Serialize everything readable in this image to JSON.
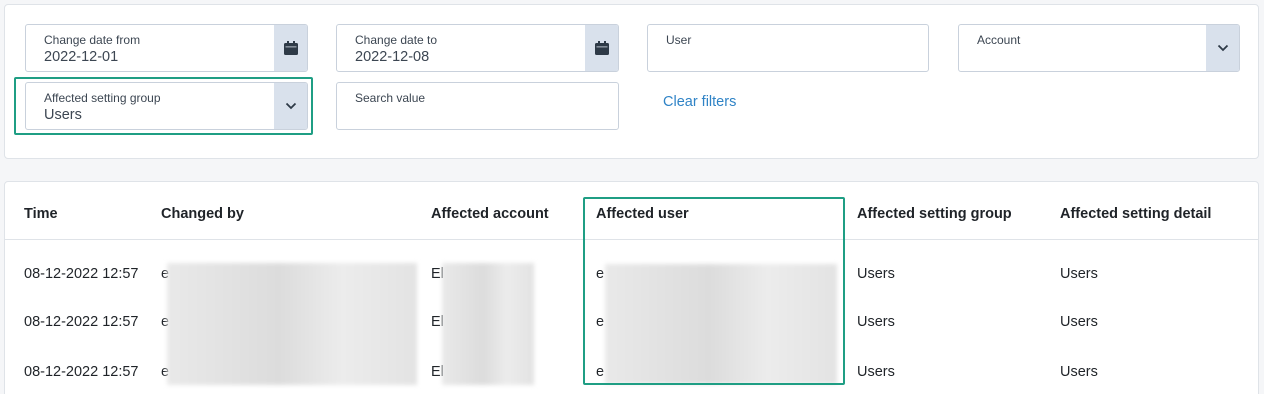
{
  "filters": {
    "date_from": {
      "label": "Change date from",
      "value": "2022-12-01",
      "icon": "calendar-icon"
    },
    "date_to": {
      "label": "Change date to",
      "value": "2022-12-08",
      "icon": "calendar-icon"
    },
    "user": {
      "label": "User",
      "value": ""
    },
    "account": {
      "label": "Account",
      "value": "",
      "icon": "chevron-down-icon"
    },
    "setting_group": {
      "label": "Affected setting group",
      "value": "Users",
      "icon": "chevron-down-icon"
    },
    "search": {
      "label": "Search value",
      "value": ""
    },
    "clear_label": "Clear filters"
  },
  "table": {
    "columns": [
      "Time",
      "Changed by",
      "Affected account",
      "Affected user",
      "Affected setting group",
      "Affected setting detail"
    ],
    "rows": [
      {
        "time": "08-12-2022 12:57",
        "changed_by": "e",
        "account": "El",
        "user": "e",
        "group": "Users",
        "detail": "Users"
      },
      {
        "time": "08-12-2022 12:57",
        "changed_by": "e",
        "account": "El",
        "user": "e",
        "group": "Users",
        "detail": "Users"
      },
      {
        "time": "08-12-2022 12:57",
        "changed_by": "e",
        "account": "El",
        "user": "e",
        "group": "Users",
        "detail": "Users"
      }
    ]
  },
  "colors": {
    "accent_highlight": "#1f9e84",
    "link": "#2f83c6",
    "icon_button_bg": "#d9e1ec"
  }
}
